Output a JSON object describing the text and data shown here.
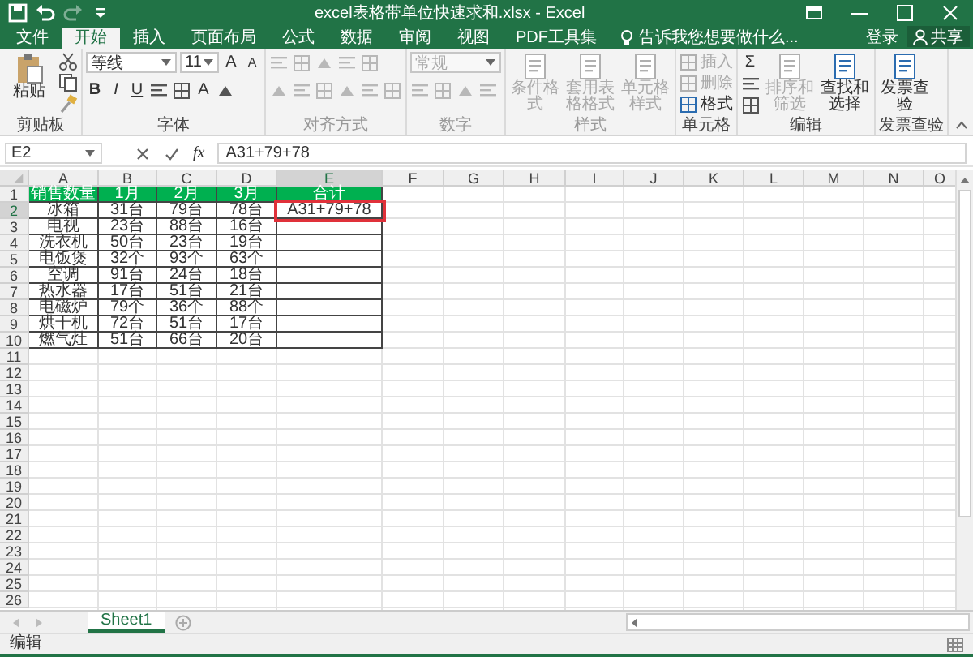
{
  "window": {
    "title": "excel表格带单位快速求和.xlsx - Excel"
  },
  "quick_access": [
    {
      "kind": "save",
      "disabled": false
    },
    {
      "kind": "undo",
      "disabled": false
    },
    {
      "kind": "redo",
      "disabled": true
    },
    {
      "kind": "customize",
      "disabled": false
    }
  ],
  "tabs": [
    {
      "label": "文件",
      "selected": false
    },
    {
      "label": "开始",
      "selected": true
    },
    {
      "label": "插入",
      "selected": false
    },
    {
      "label": "页面布局",
      "selected": false
    },
    {
      "label": "公式",
      "selected": false
    },
    {
      "label": "数据",
      "selected": false
    },
    {
      "label": "审阅",
      "selected": false
    },
    {
      "label": "视图",
      "selected": false
    },
    {
      "label": "PDF工具集",
      "selected": false
    }
  ],
  "tell_me": {
    "placeholder": "告诉我您想要做什么..."
  },
  "account": {
    "sign_in": "登录",
    "share": "共享"
  },
  "ribbon": {
    "groups": [
      {
        "label": "剪贴板",
        "disabled": false,
        "items": [
          {
            "kind": "paste",
            "label": "粘贴",
            "disabled": false
          },
          {
            "kind": "tools"
          }
        ]
      },
      {
        "label": "字体",
        "disabled": false,
        "items": [
          {
            "kind": "stack",
            "rows": [
              {
                "controls": [
                  {
                    "kind": "combo",
                    "value": "等线"
                  },
                  {
                    "kind": "combo",
                    "value": "11"
                  },
                  {
                    "kind": "glyph",
                    "text": "A"
                  },
                  {
                    "kind": "glyph",
                    "text": "A"
                  }
                ]
              },
              {
                "controls": [
                  {
                    "kind": "glyph",
                    "text": "B"
                  },
                  {
                    "kind": "glyph",
                    "text": "I"
                  },
                  {
                    "kind": "glyph",
                    "text": "U"
                  },
                  {
                    "kind": "icon"
                  },
                  {
                    "kind": "icon"
                  },
                  {
                    "kind": "glyph",
                    "text": "A"
                  },
                  {
                    "kind": "icon"
                  }
                ]
              }
            ]
          }
        ]
      },
      {
        "label": "对齐方式",
        "disabled": true,
        "items": [
          {
            "kind": "stack",
            "rows": [
              {
                "controls": [
                  {
                    "kind": "icon"
                  },
                  {
                    "kind": "icon"
                  },
                  {
                    "kind": "icon"
                  },
                  {
                    "kind": "icon"
                  },
                  {
                    "kind": "icon"
                  }
                ]
              },
              {
                "controls": [
                  {
                    "kind": "icon"
                  },
                  {
                    "kind": "icon"
                  },
                  {
                    "kind": "icon"
                  },
                  {
                    "kind": "icon"
                  },
                  {
                    "kind": "icon"
                  },
                  {
                    "kind": "icon"
                  }
                ]
              }
            ]
          }
        ]
      },
      {
        "label": "数字",
        "disabled": true,
        "items": [
          {
            "kind": "stack",
            "rows": [
              {
                "controls": [
                  {
                    "kind": "combo",
                    "value": "常规"
                  }
                ]
              },
              {
                "controls": [
                  {
                    "kind": "icon"
                  },
                  {
                    "kind": "icon"
                  },
                  {
                    "kind": "icon"
                  },
                  {
                    "kind": "icon"
                  }
                ]
              }
            ]
          }
        ]
      },
      {
        "label": "样式",
        "disabled": true,
        "items": [
          {
            "kind": "big",
            "label": "条件格式",
            "disabled": true
          },
          {
            "kind": "big",
            "label": "套用表格格式",
            "disabled": true
          },
          {
            "kind": "big",
            "label": "单元格样式",
            "disabled": true
          }
        ]
      },
      {
        "label": "单元格",
        "disabled": false,
        "items": [
          {
            "kind": "small",
            "label": "插入",
            "disabled": true
          },
          {
            "kind": "small",
            "label": "删除",
            "disabled": true
          },
          {
            "kind": "small",
            "label": "格式",
            "disabled": false
          }
        ]
      },
      {
        "label": "编辑",
        "disabled": false,
        "items": [
          {
            "kind": "stack",
            "rows": [
              {
                "controls": [
                  {
                    "kind": "glyph",
                    "text": "Σ"
                  }
                ]
              },
              {
                "controls": [
                  {
                    "kind": "icon"
                  }
                ]
              },
              {
                "controls": [
                  {
                    "kind": "icon"
                  }
                ]
              }
            ]
          },
          {
            "kind": "big",
            "label": "排序和筛选",
            "disabled": true
          },
          {
            "kind": "big",
            "label": "查找和选择",
            "disabled": false
          }
        ]
      },
      {
        "label": "发票查验",
        "disabled": false,
        "items": [
          {
            "kind": "big",
            "label": "发票查验",
            "disabled": false
          }
        ]
      }
    ]
  },
  "formula_bar": {
    "name_box": "E2",
    "function_label": "fx",
    "formula": "A31+79+78"
  },
  "sheet": {
    "columns": [
      {
        "label": "A",
        "selected": false
      },
      {
        "label": "B",
        "selected": false
      },
      {
        "label": "C",
        "selected": false
      },
      {
        "label": "D",
        "selected": false
      },
      {
        "label": "E",
        "selected": true
      },
      {
        "label": "F",
        "selected": false
      },
      {
        "label": "G",
        "selected": false
      },
      {
        "label": "H",
        "selected": false
      },
      {
        "label": "I",
        "selected": false
      },
      {
        "label": "J",
        "selected": false
      },
      {
        "label": "K",
        "selected": false
      },
      {
        "label": "L",
        "selected": false
      },
      {
        "label": "M",
        "selected": false
      },
      {
        "label": "N",
        "selected": false
      },
      {
        "label": "O",
        "selected": false
      }
    ],
    "rows": [
      {
        "label": "1",
        "kind": "header",
        "selected": false,
        "cells": [
          "销售数量",
          "1月",
          "2月",
          "3月",
          "合计"
        ]
      },
      {
        "label": "2",
        "kind": "data",
        "selected": true,
        "cells": [
          "冰箱",
          "31台",
          "79台",
          "78台",
          "A31+79+78"
        ]
      },
      {
        "label": "3",
        "kind": "data",
        "selected": false,
        "cells": [
          "电视",
          "23台",
          "88台",
          "16台"
        ]
      },
      {
        "label": "4",
        "kind": "data",
        "selected": false,
        "cells": [
          "洗衣机",
          "50台",
          "23台",
          "19台"
        ]
      },
      {
        "label": "5",
        "kind": "data",
        "selected": false,
        "cells": [
          "电饭煲",
          "32个",
          "93个",
          "63个"
        ]
      },
      {
        "label": "6",
        "kind": "data",
        "selected": false,
        "cells": [
          "空调",
          "91台",
          "24台",
          "18台"
        ]
      },
      {
        "label": "7",
        "kind": "data",
        "selected": false,
        "cells": [
          "热水器",
          "17台",
          "51台",
          "21台"
        ]
      },
      {
        "label": "8",
        "kind": "data",
        "selected": false,
        "cells": [
          "电磁炉",
          "79个",
          "36个",
          "88个"
        ]
      },
      {
        "label": "9",
        "kind": "data",
        "selected": false,
        "cells": [
          "烘干机",
          "72台",
          "51台",
          "17台"
        ]
      },
      {
        "label": "10",
        "kind": "data",
        "selected": false,
        "cells": [
          "燃气灶",
          "51台",
          "66台",
          "20台"
        ]
      },
      {
        "label": "11",
        "kind": "empty",
        "selected": false
      },
      {
        "label": "12",
        "kind": "empty",
        "selected": false
      },
      {
        "label": "13",
        "kind": "empty",
        "selected": false
      },
      {
        "label": "14",
        "kind": "empty",
        "selected": false
      },
      {
        "label": "15",
        "kind": "empty",
        "selected": false
      },
      {
        "label": "16",
        "kind": "empty",
        "selected": false
      },
      {
        "label": "17",
        "kind": "empty",
        "selected": false
      },
      {
        "label": "18",
        "kind": "empty",
        "selected": false
      },
      {
        "label": "19",
        "kind": "empty",
        "selected": false
      },
      {
        "label": "20",
        "kind": "empty",
        "selected": false
      },
      {
        "label": "21",
        "kind": "empty",
        "selected": false
      },
      {
        "label": "22",
        "kind": "empty",
        "selected": false
      },
      {
        "label": "23",
        "kind": "empty",
        "selected": false
      },
      {
        "label": "24",
        "kind": "empty",
        "selected": false
      },
      {
        "label": "25",
        "kind": "empty",
        "selected": false
      },
      {
        "label": "26",
        "kind": "empty",
        "selected": false
      }
    ]
  },
  "sheet_tabs": [
    {
      "label": "Sheet1",
      "selected": true
    }
  ],
  "status_bar": {
    "mode": "编辑"
  }
}
